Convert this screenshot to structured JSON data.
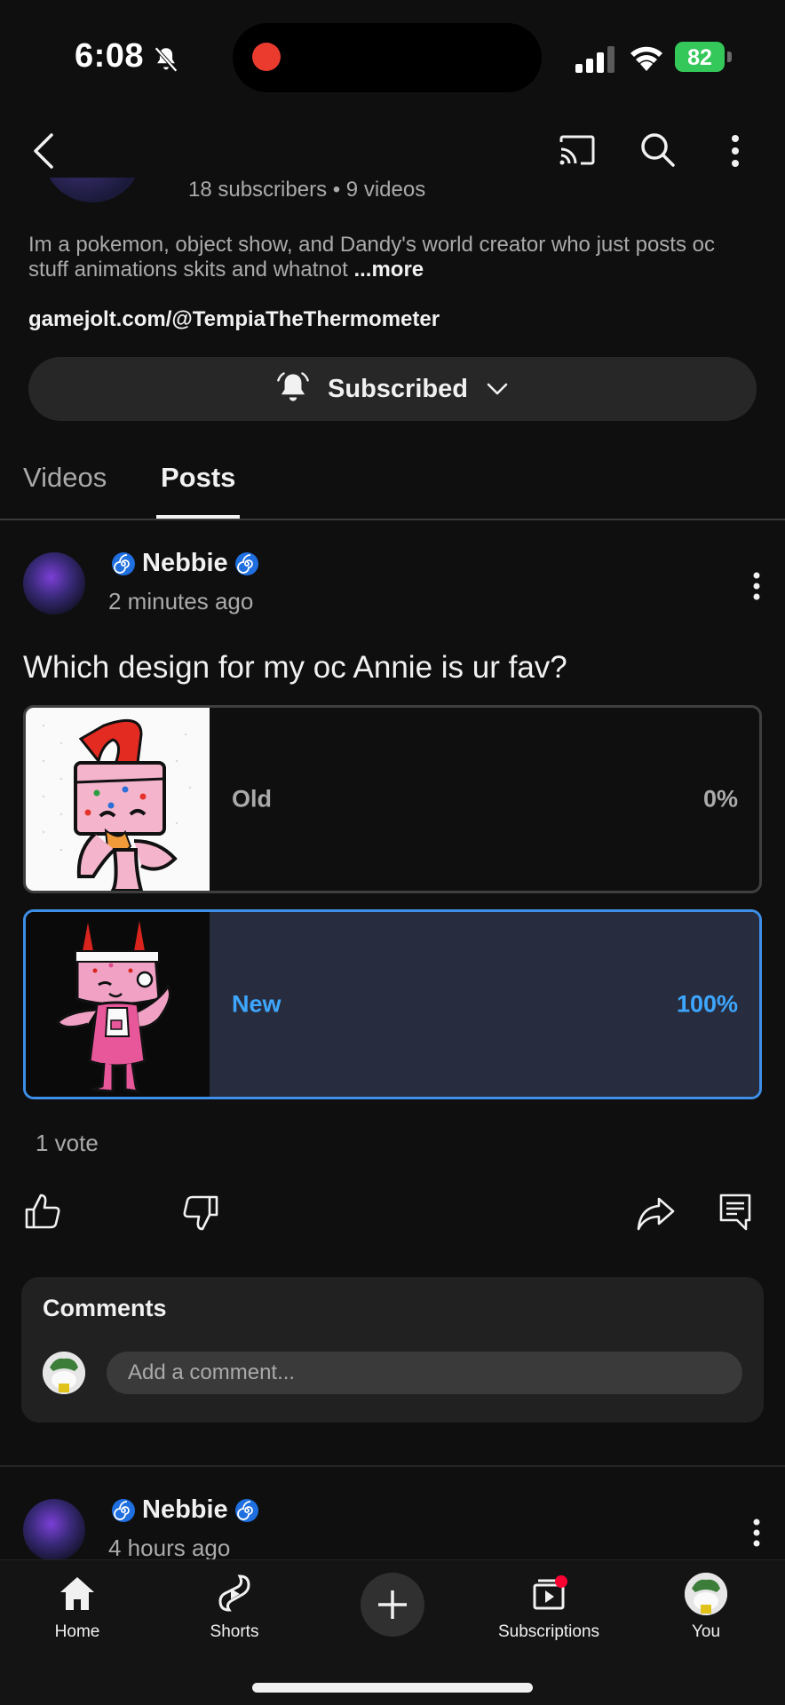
{
  "status_bar": {
    "time": "6:08",
    "battery": "82"
  },
  "channel": {
    "stats": "18 subscribers • 9 videos",
    "description": "Im a pokemon, object show, and Dandy's world creator who just posts oc stuff animations skits and whatnot",
    "more_label": "...more",
    "link": "gamejolt.com/@TempiaTheThermometer",
    "subscribe_label": "Subscribed"
  },
  "tabs": [
    {
      "label": "Videos",
      "active": false
    },
    {
      "label": "Posts",
      "active": true
    }
  ],
  "post": {
    "author": "Nebbie",
    "time": "2 minutes ago",
    "question": "Which design for my oc Annie is ur fav?",
    "options": [
      {
        "label": "Old",
        "percent_label": "0%",
        "percent": 0,
        "selected": false
      },
      {
        "label": "New",
        "percent_label": "100%",
        "percent": 100,
        "selected": true
      }
    ],
    "votes": "1 vote"
  },
  "comments": {
    "title": "Comments",
    "placeholder": "Add a comment..."
  },
  "post2": {
    "author": "Nebbie",
    "time": "4 hours ago"
  },
  "nav": {
    "home": "Home",
    "shorts": "Shorts",
    "subscriptions": "Subscriptions",
    "you": "You"
  },
  "colors": {
    "background": "#0f0f0f",
    "accent_blue": "#3ea6ff",
    "poll_selected_fill": "#272d3f",
    "record_red": "#eb3b2e",
    "battery_green": "#34c759"
  },
  "icons": [
    "back-icon",
    "cast-icon",
    "search-icon",
    "more-vert-icon",
    "bell-icon",
    "chevron-down-icon",
    "like-icon",
    "dislike-icon",
    "share-icon",
    "comment-icon",
    "home-icon",
    "shorts-icon",
    "plus-icon",
    "subscriptions-icon"
  ]
}
